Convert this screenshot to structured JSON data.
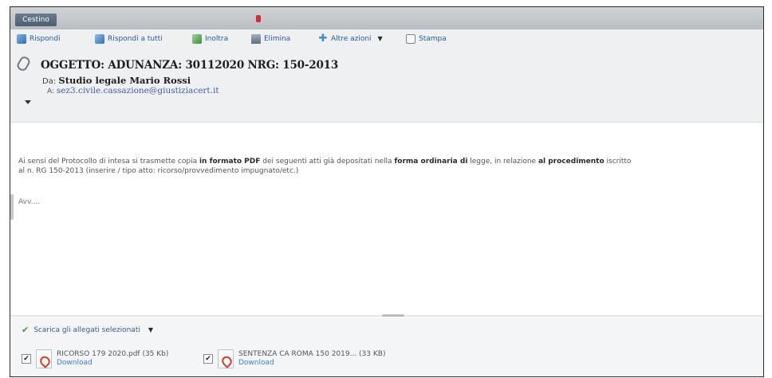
{
  "topbar": {
    "folder_tab": "Cestino"
  },
  "toolbar": {
    "reply": "Rispondi",
    "reply_all": "Rispondi a tutti",
    "forward": "Inoltra",
    "delete": "Elimina",
    "more_actions": "Altre azioni",
    "print": "Stampa"
  },
  "header": {
    "subject": "OGGETTO: ADUNANZA: 30112020 NRG: 150-2013",
    "from_label": "Da:",
    "from_name": "Studio legale Mario Rossi",
    "to_label": "A:",
    "to_address": "sez3.civile.cassazione@giustiziacert.it"
  },
  "body": {
    "p1": "Ai sensi del Protocollo di intesa si trasmette copia ",
    "p1_b1": "in formato PDF",
    "p1_2": " dei seguenti atti già depositati nella ",
    "p1_b2": "forma ordinaria di",
    "p1_3": " legge, in relazione ",
    "p1_b3": "al procedimento",
    "p1_4": " iscritto",
    "p2": "al n. RG 150-2013  (inserire / tipo atto: ricorso/provvedimento impugnato/etc.)",
    "signature": "Avv...."
  },
  "attachments": {
    "download_selected": "Scarica gli allegati selezionati",
    "items": [
      {
        "name": "RICORSO 179 2020.pdf (35 Kb)",
        "download": "Download"
      },
      {
        "name": "SENTENZA CA ROMA 150 2019... (33 KB)",
        "download": "Download"
      }
    ]
  }
}
